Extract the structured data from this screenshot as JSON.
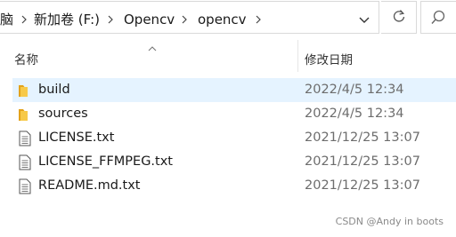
{
  "address_bar": {
    "crumbs": [
      "脑",
      "新加卷 (F:)",
      "Opencv",
      "opencv"
    ]
  },
  "columns": {
    "name": "名称",
    "modified": "修改日期"
  },
  "files": [
    {
      "name": "build",
      "modified": "2022/4/5 12:34",
      "type": "folder",
      "selected": true
    },
    {
      "name": "sources",
      "modified": "2022/4/5 12:34",
      "type": "folder",
      "selected": false
    },
    {
      "name": "LICENSE.txt",
      "modified": "2021/12/25 13:07",
      "type": "text-file",
      "selected": false
    },
    {
      "name": "LICENSE_FFMPEG.txt",
      "modified": "2021/12/25 13:07",
      "type": "text-file",
      "selected": false
    },
    {
      "name": "README.md.txt",
      "modified": "2021/12/25 13:07",
      "type": "text-file",
      "selected": false
    }
  ],
  "watermark": "CSDN @Andy in boots",
  "colors": {
    "selected_row": "#e5f3ff",
    "folder": "#f7c948",
    "date_text": "#6d6d6d"
  },
  "icons": {
    "address_dropdown": "chevron-down-icon",
    "refresh": "refresh-icon",
    "search": "search-icon",
    "sort": "sort-up-icon",
    "folder": "folder-icon",
    "text_file": "text-file-icon"
  }
}
